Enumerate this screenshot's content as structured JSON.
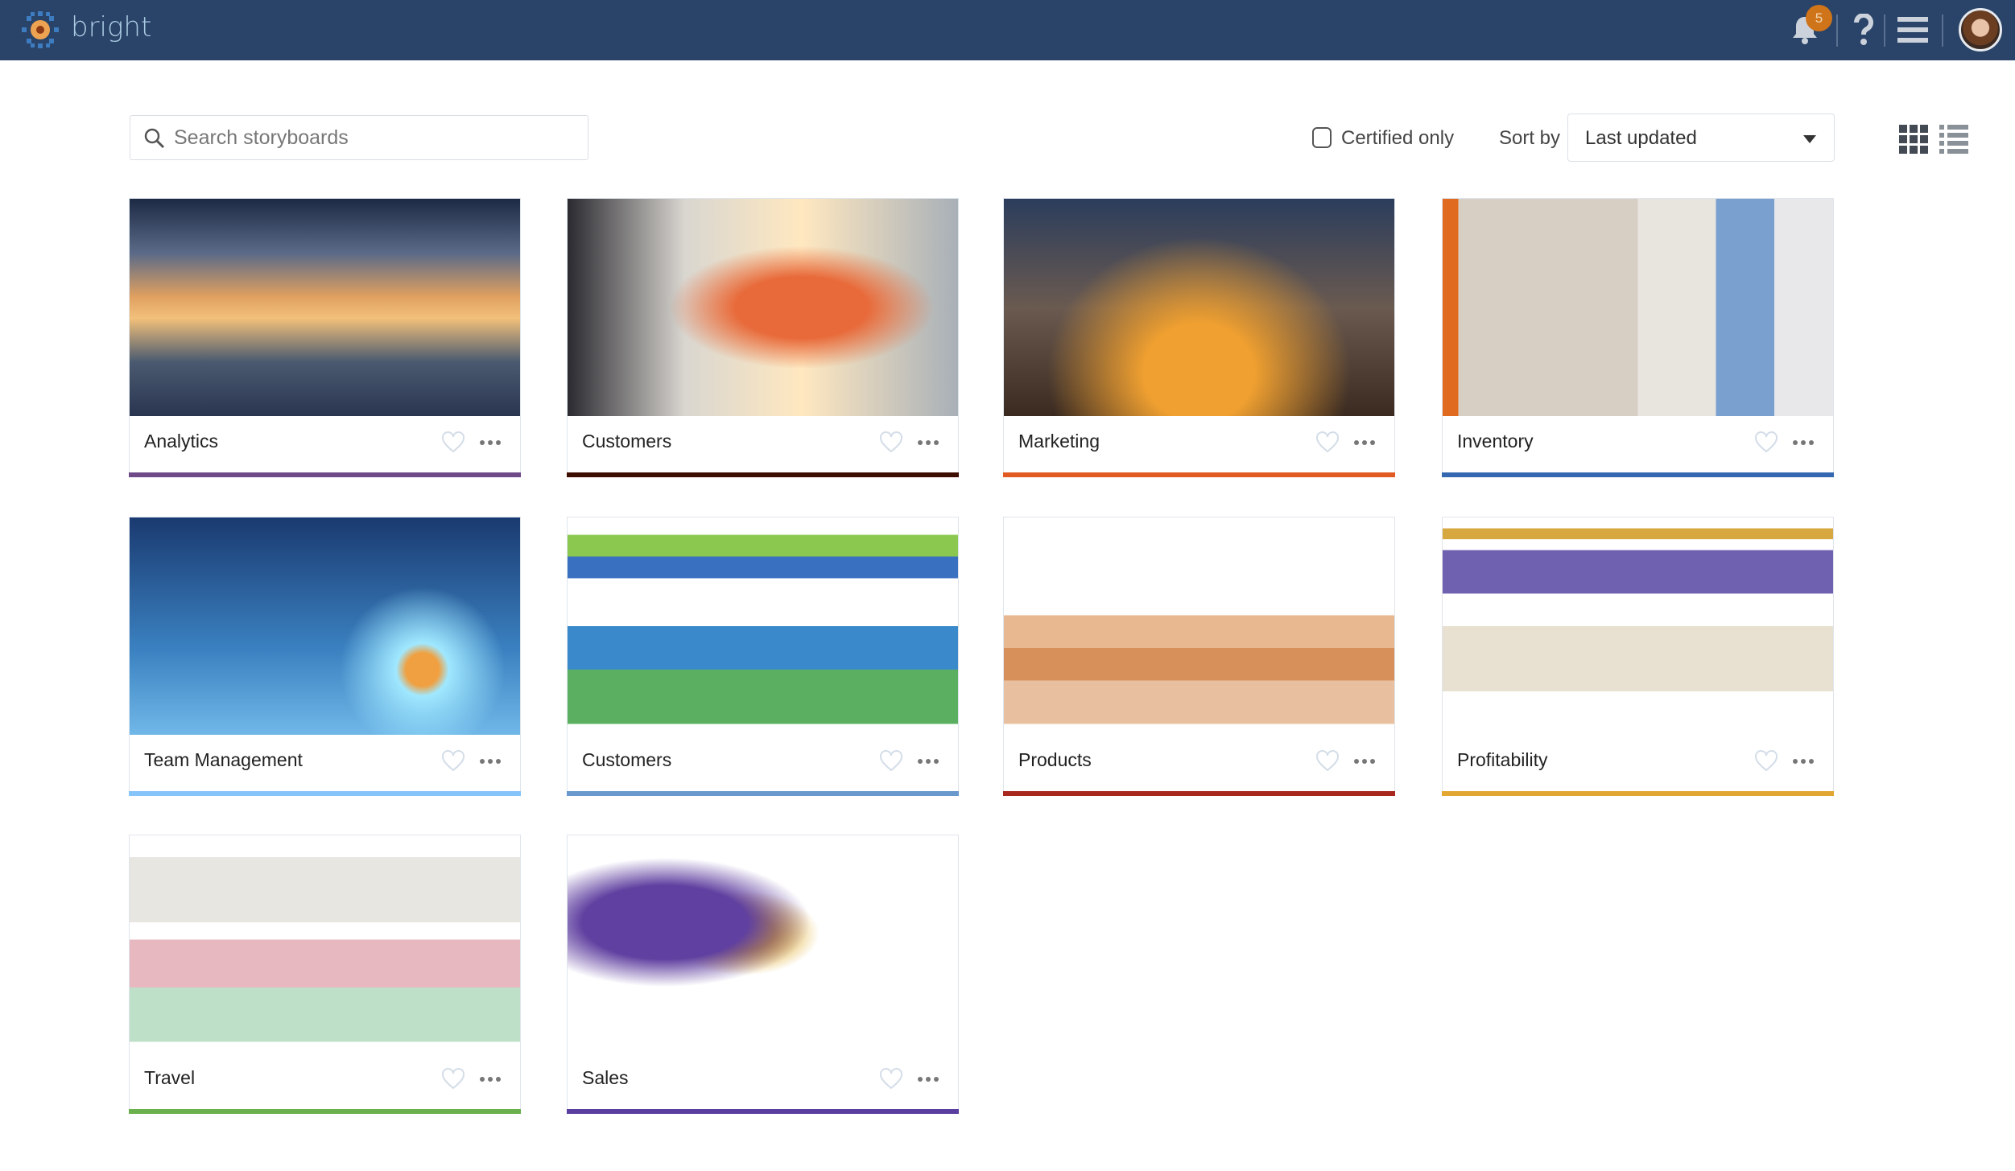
{
  "header": {
    "brand": "bright",
    "notifications_count": "5",
    "icons": [
      "bell-icon",
      "help-icon",
      "menu-icon",
      "avatar"
    ]
  },
  "toolbar": {
    "search_placeholder": "Search storyboards",
    "certified_label": "Certified only",
    "certified_checked": false,
    "sort_label": "Sort by",
    "sort_value": "Last updated",
    "view_modes": [
      "grid-view-icon",
      "list-view-icon"
    ],
    "active_view": "grid"
  },
  "cards": [
    {
      "title": "Analytics",
      "color": "#6e4a88",
      "thumb": "city-finance-photo"
    },
    {
      "title": "Customers",
      "color": "#3d0d00",
      "thumb": "handshake-photo"
    },
    {
      "title": "Marketing",
      "color": "#e05a22",
      "thumb": "network-city-photo"
    },
    {
      "title": "Inventory",
      "color": "#3468b0",
      "thumb": "warehouse-photo"
    },
    {
      "title": "Team Management",
      "color": "#86c5fa",
      "thumb": "team-network-photo"
    },
    {
      "title": "Customers",
      "color": "#6898cc",
      "thumb": "area-chart-dashboard"
    },
    {
      "title": "Products",
      "color": "#a82820",
      "thumb": "heatmap-dashboard"
    },
    {
      "title": "Profitability",
      "color": "#e2a632",
      "thumb": "bar-line-dashboard"
    },
    {
      "title": "Travel",
      "color": "#6ab04c",
      "thumb": "sankey-dashboard"
    },
    {
      "title": "Sales",
      "color": "#5a3ea0",
      "thumb": "world-map-dashboard"
    }
  ]
}
